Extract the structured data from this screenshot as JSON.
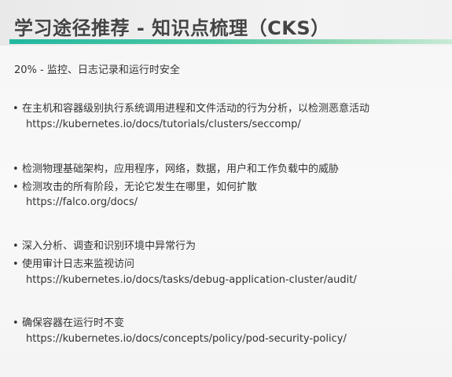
{
  "header": {
    "title": "学习途径推荐 - 知识点梳理（CKS）",
    "accent_color": "#21b8a0"
  },
  "subtitle": "20% - 监控、日志记录和运行时安全",
  "bullet_symbol": "•",
  "sections": [
    {
      "bullets": [
        "在主机和容器级别执行系统调用进程和文件活动的行为分析，以检测恶意活动"
      ],
      "url": "https://kubernetes.io/docs/tutorials/clusters/seccomp/"
    },
    {
      "bullets": [
        "检测物理基础架构，应用程序，网络，数据，用户和工作负载中的威胁",
        "检测攻击的所有阶段，无论它发生在哪里，如何扩散"
      ],
      "url": "https://falco.org/docs/"
    },
    {
      "bullets": [
        "深入分析、调查和识别环境中异常行为",
        "使用审计日志来监视访问"
      ],
      "url": "https://kubernetes.io/docs/tasks/debug-application-cluster/audit/"
    },
    {
      "bullets": [
        "确保容器在运行时不变"
      ],
      "url": "https://kubernetes.io/docs/concepts/policy/pod-security-policy/"
    }
  ]
}
